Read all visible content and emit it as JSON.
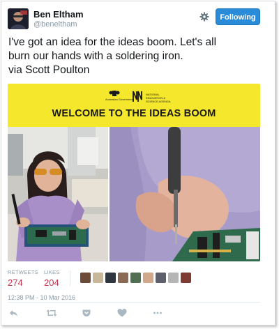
{
  "user": {
    "display_name": "Ben Eltham",
    "handle": "@beneltham"
  },
  "follow_button": {
    "label": "Following"
  },
  "tweet": {
    "line1": "I've got an idea for the ideas boom. Let's all",
    "line2": "burn our hands with a soldering iron.",
    "line3": "via Scott Poulton"
  },
  "media": {
    "banner_title": "WELCOME TO THE IDEAS BOOM",
    "gov_text": "Australian Government",
    "nisa_text": "NATIONAL INNOVATION & SCIENCE AGENDA"
  },
  "stats": {
    "retweets_label": "RETWEETS",
    "retweets_value": "274",
    "likes_label": "LIKES",
    "likes_value": "204"
  },
  "timestamp": "12:38 PM - 10 Mar 2016",
  "colors": {
    "accent": "#2a8cd8",
    "stat_value": "#c0334f",
    "banner": "#f5e72b"
  },
  "icons": [
    "gear-icon",
    "reply-icon",
    "retweet-icon",
    "heart-icon",
    "more-icon"
  ]
}
